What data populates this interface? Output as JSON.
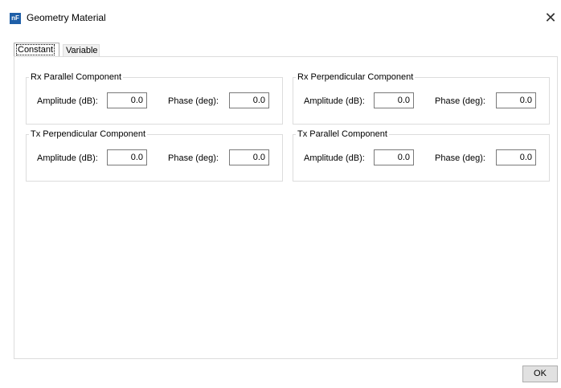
{
  "window": {
    "title": "Geometry Material",
    "icon_text": "nF",
    "close_glyph": "✕"
  },
  "tabs": [
    {
      "label": "Constant",
      "selected": true
    },
    {
      "label": "Variable",
      "selected": false
    }
  ],
  "groups": [
    {
      "title": "Rx Parallel Component",
      "amplitude_label": "Amplitude (dB):",
      "amplitude_value": "0.0",
      "phase_label": "Phase (deg):",
      "phase_value": "0.0"
    },
    {
      "title": "Rx Perpendicular Component",
      "amplitude_label": "Amplitude (dB):",
      "amplitude_value": "0.0",
      "phase_label": "Phase (deg):",
      "phase_value": "0.0"
    },
    {
      "title": "Tx Perpendicular Component",
      "amplitude_label": "Amplitude (dB):",
      "amplitude_value": "0.0",
      "phase_label": "Phase (deg):",
      "phase_value": "0.0"
    },
    {
      "title": "Tx Parallel Component",
      "amplitude_label": "Amplitude (dB):",
      "amplitude_value": "0.0",
      "phase_label": "Phase (deg):",
      "phase_value": "0.0"
    }
  ],
  "buttons": {
    "ok_label": "OK"
  },
  "colors": {
    "icon_bg": "#1f5fa8",
    "border": "#dcdcdc",
    "button_bg": "#e1e1e1"
  }
}
